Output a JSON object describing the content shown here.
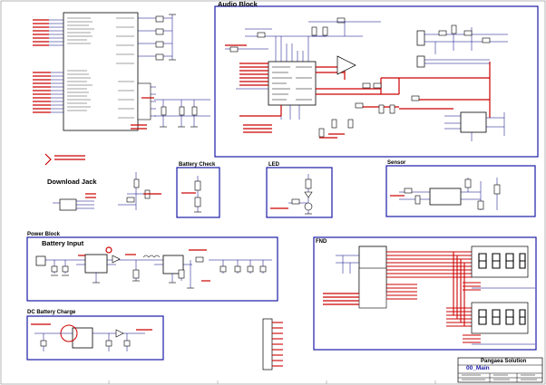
{
  "blocks": {
    "audio": "Audio Block",
    "battery_check": "Battery Check",
    "led": "LED",
    "sensor": "Sensor",
    "download_jack": "Download Jack",
    "power": "Power Block",
    "battery_input": "Battery Input",
    "fnd": "FND",
    "dc_battery_charge": "DC Battery Charge"
  },
  "title_block": {
    "company": "Pangaea Solution",
    "sheet_title": "00_Main"
  },
  "colors": {
    "wire": "#000080",
    "net_label": "#cc0000",
    "block_border": "#1a1aa8",
    "component": "#000000"
  }
}
